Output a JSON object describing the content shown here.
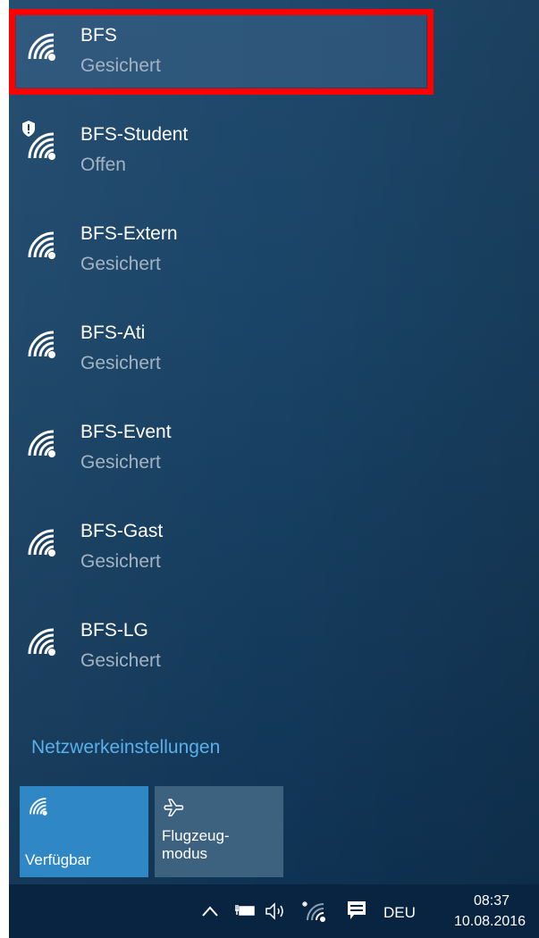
{
  "networks": [
    {
      "name": "BFS",
      "status": "Gesichert",
      "selected": true,
      "secured_warning": false
    },
    {
      "name": "BFS-Student",
      "status": "Offen",
      "selected": false,
      "secured_warning": true
    },
    {
      "name": "BFS-Extern",
      "status": "Gesichert",
      "selected": false,
      "secured_warning": false
    },
    {
      "name": "BFS-Ati",
      "status": "Gesichert",
      "selected": false,
      "secured_warning": false
    },
    {
      "name": "BFS-Event",
      "status": "Gesichert",
      "selected": false,
      "secured_warning": false
    },
    {
      "name": "BFS-Gast",
      "status": "Gesichert",
      "selected": false,
      "secured_warning": false
    },
    {
      "name": "BFS-LG",
      "status": "Gesichert",
      "selected": false,
      "secured_warning": false
    }
  ],
  "network_settings_link": "Netzwerkeinstellungen",
  "tiles": {
    "wifi": {
      "label": "Verfügbar",
      "icon": "wifi-icon"
    },
    "airplane": {
      "label_line1": "Flugzeug-",
      "label_line2": "modus",
      "icon": "airplane-icon"
    }
  },
  "taskbar": {
    "language": "DEU",
    "time": "08:37",
    "date": "10.08.2016",
    "icons": [
      "chevron-up-icon",
      "power-icon",
      "volume-icon",
      "wifi-icon",
      "notification-icon"
    ]
  },
  "colors": {
    "panel_bg": "#1a4467",
    "highlight": "#ff0000",
    "link": "#5ab0ea",
    "tile_active": "#2f87c6",
    "tile_inactive": "#3c627f",
    "taskbar_bg": "#082440"
  }
}
